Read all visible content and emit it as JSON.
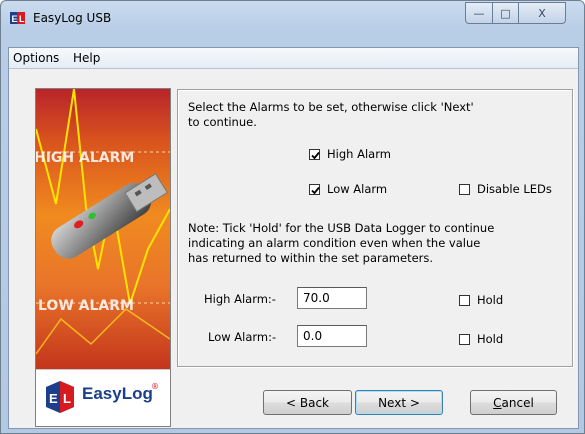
{
  "window": {
    "title": "EasyLog USB",
    "controls": {
      "minimize": "—",
      "maximize": "□",
      "close": "X"
    }
  },
  "menu": {
    "items": [
      "Options",
      "Help"
    ]
  },
  "banner": {
    "high_label": "HIGH ALARM",
    "low_label": "LOW ALARM",
    "logo_text": "EasyLog",
    "logo_reg": "®"
  },
  "instructions": {
    "line1": "Select the Alarms to be set, otherwise click 'Next'",
    "line2": "to continue."
  },
  "checkboxes": {
    "high_alarm": {
      "label": "High Alarm",
      "checked": true
    },
    "low_alarm": {
      "label": "Low Alarm",
      "checked": true
    },
    "disable_leds": {
      "label": "Disable LEDs",
      "checked": false
    }
  },
  "note": {
    "line1": "Note: Tick 'Hold' for the USB Data Logger to continue",
    "line2": "indicating an alarm condition even when the value",
    "line3": "has returned to within the set parameters."
  },
  "fields": {
    "high": {
      "label": "High Alarm:-",
      "value": "70.0",
      "hold_label": "Hold",
      "hold_checked": false
    },
    "low": {
      "label": "Low Alarm:-",
      "value": "0.0",
      "hold_label": "Hold",
      "hold_checked": false
    }
  },
  "buttons": {
    "back": "< Back",
    "next": "Next >",
    "cancel_first": "C",
    "cancel_rest": "ancel"
  },
  "colors": {
    "accent": "#1b3f8b",
    "banner_orange": "#e8731e",
    "banner_red": "#c8361a",
    "logo_red": "#d71920"
  }
}
